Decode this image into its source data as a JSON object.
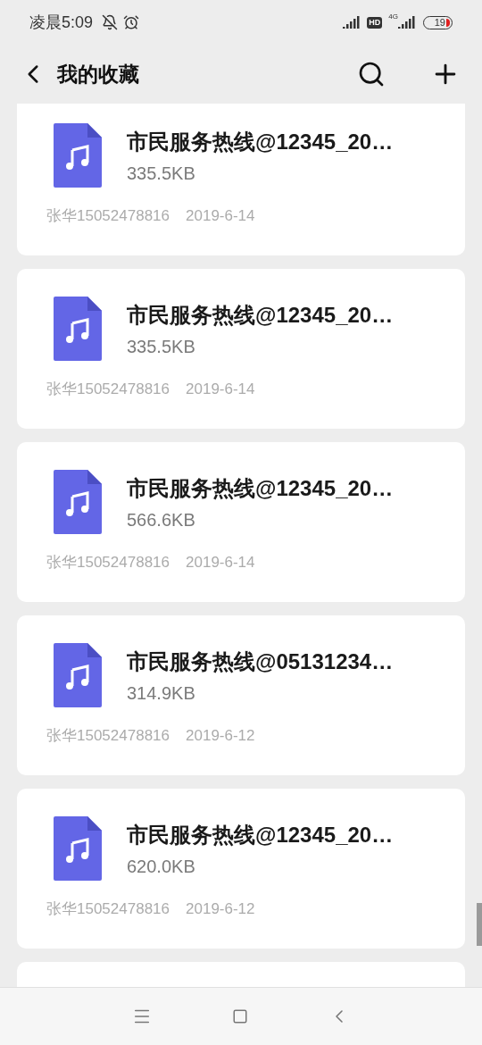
{
  "status_bar": {
    "time": "凌晨5:09",
    "hd": "HD",
    "network": "4G",
    "battery": "19"
  },
  "header": {
    "title": "我的收藏"
  },
  "items": [
    {
      "title": "市民服务热线@12345_20…",
      "size": "335.5KB",
      "sender": "张华15052478816",
      "date": "2019-6-14"
    },
    {
      "title": "市民服务热线@12345_20…",
      "size": "335.5KB",
      "sender": "张华15052478816",
      "date": "2019-6-14"
    },
    {
      "title": "市民服务热线@12345_20…",
      "size": "566.6KB",
      "sender": "张华15052478816",
      "date": "2019-6-14"
    },
    {
      "title": "市民服务热线@05131234…",
      "size": "314.9KB",
      "sender": "张华15052478816",
      "date": "2019-6-12"
    },
    {
      "title": "市民服务热线@12345_20…",
      "size": "620.0KB",
      "sender": "张华15052478816",
      "date": "2019-6-12"
    }
  ]
}
